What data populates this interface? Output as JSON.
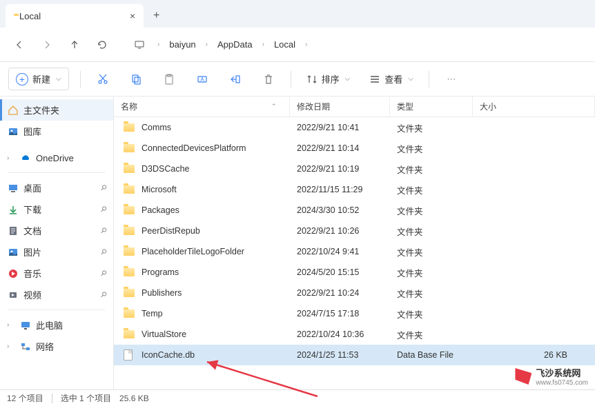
{
  "tab": {
    "title": "Local"
  },
  "breadcrumb": [
    "baiyun",
    "AppData",
    "Local"
  ],
  "toolbar": {
    "new": "新建",
    "sort": "排序",
    "view": "查看"
  },
  "columns": {
    "name": "名称",
    "date": "修改日期",
    "type": "类型",
    "size": "大小"
  },
  "sidebar": {
    "home": "主文件夹",
    "gallery": "图库",
    "onedrive": "OneDrive",
    "quick": [
      {
        "label": "桌面"
      },
      {
        "label": "下载"
      },
      {
        "label": "文档"
      },
      {
        "label": "图片"
      },
      {
        "label": "音乐"
      },
      {
        "label": "视频"
      }
    ],
    "thispc": "此电脑",
    "network": "网络"
  },
  "files": [
    {
      "name": "Comms",
      "date": "2022/9/21 10:41",
      "type": "文件夹",
      "size": "",
      "kind": "folder"
    },
    {
      "name": "ConnectedDevicesPlatform",
      "date": "2022/9/21 10:14",
      "type": "文件夹",
      "size": "",
      "kind": "folder"
    },
    {
      "name": "D3DSCache",
      "date": "2022/9/21 10:19",
      "type": "文件夹",
      "size": "",
      "kind": "folder"
    },
    {
      "name": "Microsoft",
      "date": "2022/11/15 11:29",
      "type": "文件夹",
      "size": "",
      "kind": "folder"
    },
    {
      "name": "Packages",
      "date": "2024/3/30 10:52",
      "type": "文件夹",
      "size": "",
      "kind": "folder"
    },
    {
      "name": "PeerDistRepub",
      "date": "2022/9/21 10:26",
      "type": "文件夹",
      "size": "",
      "kind": "folder"
    },
    {
      "name": "PlaceholderTileLogoFolder",
      "date": "2022/10/24 9:41",
      "type": "文件夹",
      "size": "",
      "kind": "folder"
    },
    {
      "name": "Programs",
      "date": "2024/5/20 15:15",
      "type": "文件夹",
      "size": "",
      "kind": "folder"
    },
    {
      "name": "Publishers",
      "date": "2022/9/21 10:24",
      "type": "文件夹",
      "size": "",
      "kind": "folder"
    },
    {
      "name": "Temp",
      "date": "2024/7/15 17:18",
      "type": "文件夹",
      "size": "",
      "kind": "folder"
    },
    {
      "name": "VirtualStore",
      "date": "2022/10/24 10:36",
      "type": "文件夹",
      "size": "",
      "kind": "folder"
    },
    {
      "name": "IconCache.db",
      "date": "2024/1/25 11:53",
      "type": "Data Base File",
      "size": "26 KB",
      "kind": "file",
      "selected": true
    }
  ],
  "status": {
    "items": "12 个项目",
    "selected": "选中 1 个项目",
    "size": "25.6 KB"
  },
  "watermark": {
    "name": "飞沙系统网",
    "url": "www.fs0745.com"
  }
}
